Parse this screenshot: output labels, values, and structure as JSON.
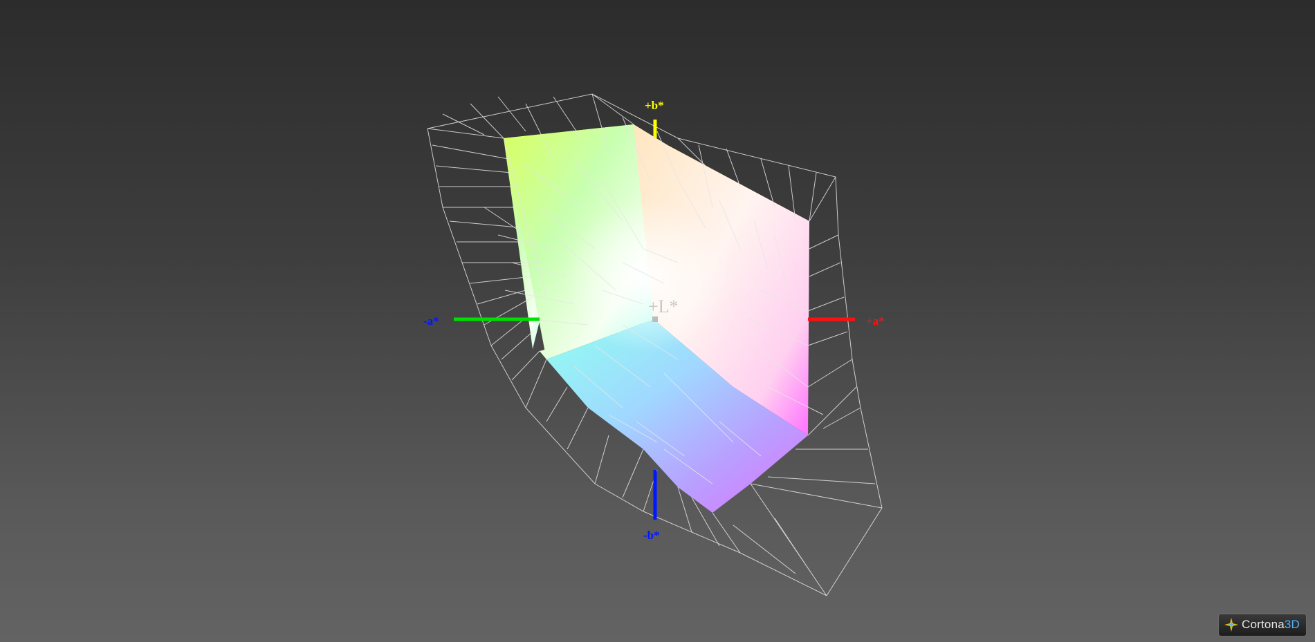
{
  "axes": {
    "plus_b": "+b*",
    "minus_b": "-b*",
    "plus_a": "+a*",
    "minus_a": "-a*",
    "plus_L": "+L*"
  },
  "colors": {
    "plus_b": "#ffff00",
    "minus_b": "#0000ff",
    "plus_a": "#ff0000",
    "minus_a": "#00ff00",
    "plus_L": "#c8c8c8"
  },
  "logo": {
    "name_part1": "Cortona",
    "name_part2": "3D",
    "icon": "cortona-star-icon"
  }
}
